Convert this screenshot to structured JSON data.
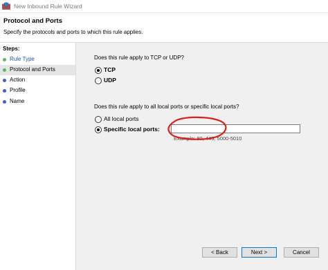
{
  "window": {
    "title": "New Inbound Rule Wizard"
  },
  "header": {
    "title": "Protocol and Ports",
    "subtitle": "Specify the protocols and ports to which this rule applies."
  },
  "sidebar": {
    "title": "Steps:",
    "items": [
      {
        "label": "Rule Type",
        "state": "completed",
        "color": "#5cb85c"
      },
      {
        "label": "Protocol and Ports",
        "state": "current",
        "color": "#5cb85c"
      },
      {
        "label": "Action",
        "state": "pending",
        "color": "#3a5fcd"
      },
      {
        "label": "Profile",
        "state": "pending",
        "color": "#3a5fcd"
      },
      {
        "label": "Name",
        "state": "pending",
        "color": "#3a5fcd"
      }
    ]
  },
  "protocol": {
    "question": "Does this rule apply to TCP or UDP?",
    "options": [
      {
        "label": "TCP",
        "selected": true
      },
      {
        "label": "UDP",
        "selected": false
      }
    ]
  },
  "ports": {
    "question": "Does this rule apply to all local ports or specific local ports?",
    "all_label": "All local ports",
    "specific_label": "Specific local ports:",
    "selected": "specific",
    "value": "",
    "example": "Example: 80, 443, 5000-5010"
  },
  "annotation": {
    "shape": "ellipse",
    "color": "#d9201b"
  },
  "buttons": {
    "back": "< Back",
    "next": "Next >",
    "cancel": "Cancel"
  }
}
